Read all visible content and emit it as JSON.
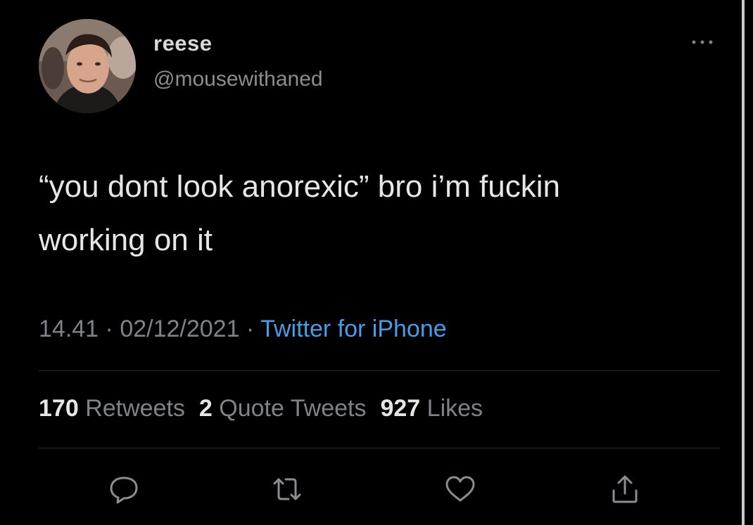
{
  "tweet": {
    "author": {
      "display_name": "reese",
      "handle": "@mousewithaned",
      "avatar_icon": "profile-photo"
    },
    "more_icon": "ellipsis-icon",
    "text": "“you dont look anorexic” bro i’m fuckin\nworking on it",
    "time": "14.41",
    "date": "02/12/2021",
    "separator": " · ",
    "source": "Twitter for iPhone",
    "stats": {
      "retweets_count": "170",
      "retweets_label": "Retweets",
      "quotes_count": "2",
      "quotes_label": "Quote Tweets",
      "likes_count": "927",
      "likes_label": "Likes"
    },
    "actions": [
      "reply-icon",
      "retweet-icon",
      "like-icon",
      "share-icon"
    ]
  },
  "colors": {
    "background": "#000000",
    "text": "#e6e6e6",
    "secondary": "#7f8286",
    "link": "#4a9ce6"
  }
}
